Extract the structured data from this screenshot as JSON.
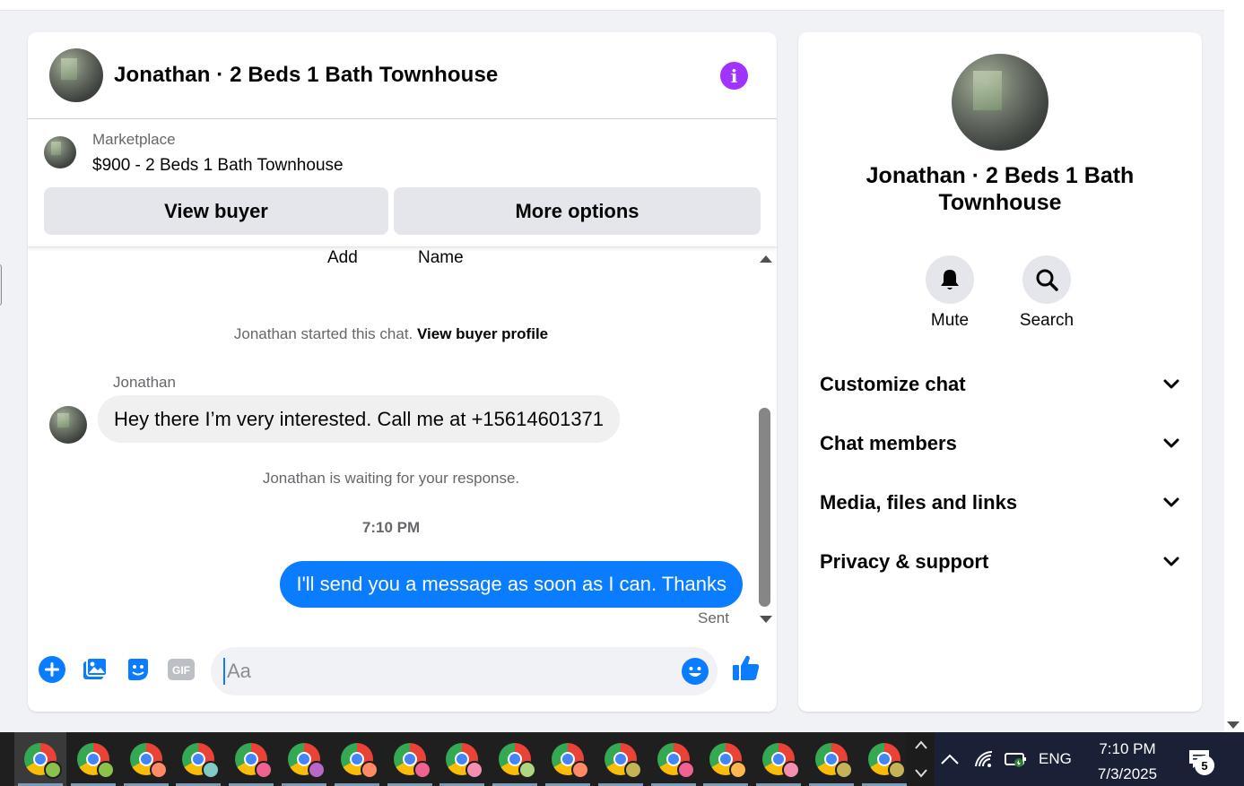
{
  "chat": {
    "title": "Jonathan · 2 Beds 1 Bath Townhouse",
    "info_icon": "info-icon",
    "marketplace": {
      "category": "Marketplace",
      "listing": "$900 - 2 Beds 1 Bath Townhouse",
      "view_buyer_label": "View buyer",
      "more_options_label": "More options"
    },
    "partial_labels": {
      "add": "Add",
      "name": "Name"
    },
    "started_text": "Jonathan started this chat.",
    "view_profile_link": "View buyer profile",
    "incoming": {
      "sender": "Jonathan",
      "text": "Hey there I’m very interested. Call me at +15614601371"
    },
    "waiting_text": "Jonathan is waiting for your response.",
    "time_separator": "7:10 PM",
    "outgoing": {
      "text": "I'll send you a message as soon as I can. Thanks",
      "status": "Sent"
    },
    "composer": {
      "placeholder": "Aa",
      "icons": [
        "plus-icon",
        "photo-icon",
        "sticker-icon",
        "gif-icon",
        "emoji-icon",
        "like-icon"
      ]
    }
  },
  "info_panel": {
    "title": "Jonathan · 2 Beds 1 Bath Townhouse",
    "actions": [
      {
        "label": "Mute",
        "icon": "bell-icon"
      },
      {
        "label": "Search",
        "icon": "search-icon"
      }
    ],
    "sections": [
      {
        "label": "Customize chat"
      },
      {
        "label": "Chat members"
      },
      {
        "label": "Media, files and links"
      },
      {
        "label": "Privacy & support"
      }
    ]
  },
  "taskbar": {
    "language": "ENG",
    "time": "7:10 PM",
    "date": "7/3/2025",
    "notification_count": "5",
    "profile_badge_colors": [
      "#8bc34a",
      "#8bc34a",
      "#ff8a65",
      "#80cbc4",
      "#f06292",
      "#ba68c8",
      "#ff8a65",
      "#f06292",
      "#f48fb1",
      "#aed581",
      "#ff8a65",
      "#c5b358",
      "#f06292",
      "#ffb74d",
      "#f48fb1",
      "#c5b358",
      "#c5b358"
    ]
  },
  "colors": {
    "accent": "#0a7cff",
    "info": "#a033ff",
    "bubble_in": "#f0f0f0"
  }
}
